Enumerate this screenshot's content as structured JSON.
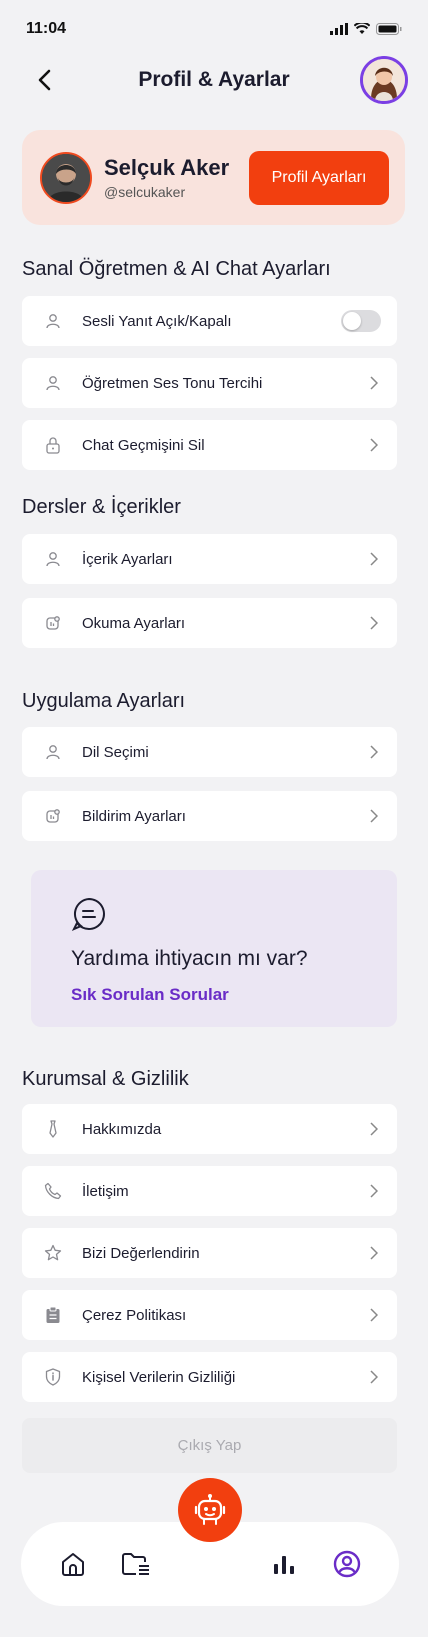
{
  "status": {
    "time": "11:04"
  },
  "header": {
    "title": "Profil & Ayarlar"
  },
  "profile": {
    "name": "Selçuk Aker",
    "username": "@selcukaker",
    "button_label": "Profil Ayarları"
  },
  "sections": {
    "ai": {
      "title": "Sanal Öğretmen & AI Chat Ayarları",
      "items": [
        {
          "label": "Sesli Yanıt Açık/Kapalı",
          "icon": "user-icon",
          "toggle": false
        },
        {
          "label": "Öğretmen Ses Tonu Tercihi",
          "icon": "user-icon"
        },
        {
          "label": "Chat Geçmişini Sil",
          "icon": "lock-icon"
        }
      ]
    },
    "lessons": {
      "title": "Dersler & İçerikler",
      "items": [
        {
          "label": "İçerik Ayarları",
          "icon": "user-icon"
        },
        {
          "label": "Okuma Ayarları",
          "icon": "notification-icon"
        }
      ]
    },
    "app": {
      "title": "Uygulama Ayarları",
      "items": [
        {
          "label": "Dil Seçimi",
          "icon": "user-icon"
        },
        {
          "label": "Bildirim Ayarları",
          "icon": "notification-icon"
        }
      ]
    },
    "corporate": {
      "title": "Kurumsal & Gizlilik",
      "items": [
        {
          "label": "Hakkımızda",
          "icon": "tie-icon"
        },
        {
          "label": "İletişim",
          "icon": "phone-icon"
        },
        {
          "label": "Bizi Değerlendirin",
          "icon": "star-icon"
        },
        {
          "label": "Çerez Politikası",
          "icon": "clipboard-icon"
        },
        {
          "label": "Kişisel Verilerin Gizliliği",
          "icon": "shield-icon"
        }
      ]
    }
  },
  "help": {
    "title": "Yardıma ihtiyacın mı var?",
    "link": "Sık Sorulan Sorular"
  },
  "logout": {
    "label": "Çıkış Yap"
  },
  "colors": {
    "accent": "#f23f0f",
    "purple": "#6a2cc7",
    "background": "#f2f2f4"
  }
}
